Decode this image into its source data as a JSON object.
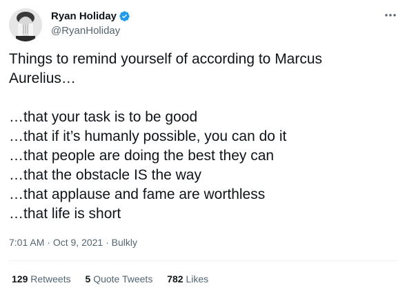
{
  "author": {
    "name": "Ryan Holiday",
    "handle": "@RyanHoliday",
    "verified": true
  },
  "tweet": {
    "intro_line1": "Things to remind yourself of according to Marcus",
    "intro_line2": "Aurelius…",
    "items": [
      "…that your task is to be good",
      "…that if it’s humanly possible, you can do it",
      "…that people are doing the best they can",
      "…that the obstacle IS the way",
      "…that applause and fame are worthless",
      "…that life is short"
    ]
  },
  "meta": {
    "time": "7:01 AM",
    "sep1": " · ",
    "date": "Oct 9, 2021",
    "sep2": " · ",
    "source": "Bulkly"
  },
  "stats": {
    "retweets_count": "129",
    "retweets_label": "Retweets",
    "quotes_count": "5",
    "quotes_label": "Quote Tweets",
    "likes_count": "782",
    "likes_label": "Likes"
  },
  "colors": {
    "accent": "#1d9bf0",
    "text": "#0f1419",
    "secondary": "#536471"
  },
  "icons": {
    "verified": "verified-badge-icon",
    "more": "more-dots-icon"
  }
}
